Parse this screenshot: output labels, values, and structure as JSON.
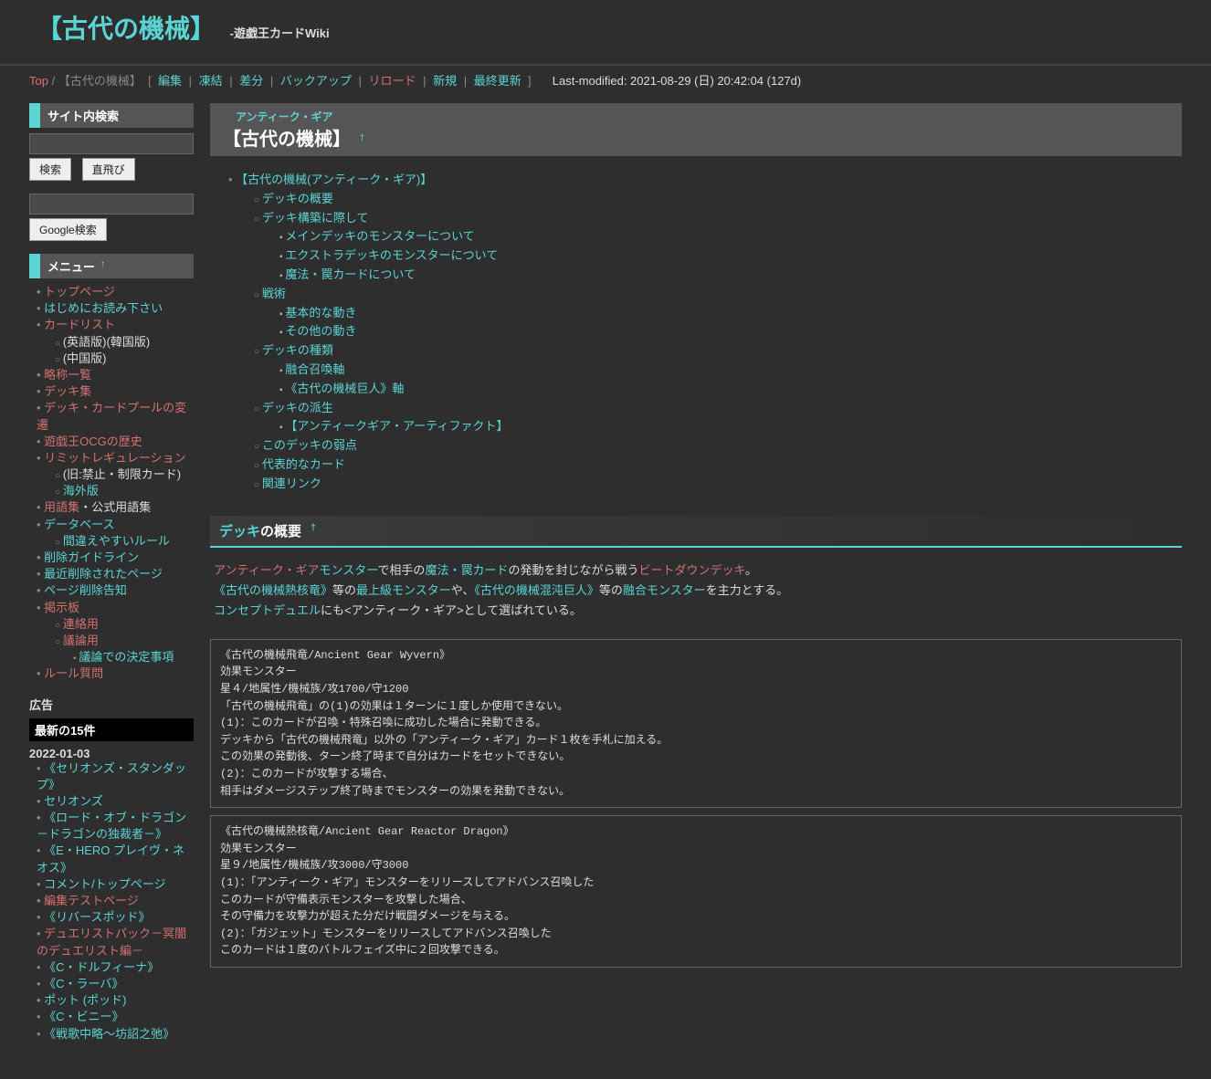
{
  "header": {
    "title": "【古代の機械】",
    "subtitle": "-遊戯王カードWiki"
  },
  "topbar": {
    "top": "Top",
    "here": "【古代の機械】",
    "links": [
      "編集",
      "凍結",
      "差分",
      "バックアップ",
      "リロード",
      "新規",
      "最終更新"
    ],
    "lastmod": "Last-modified: 2021-08-29 (日) 20:42:04 (127d)"
  },
  "sidebar": {
    "search_title": "サイト内検索",
    "btn_search": "検索",
    "btn_jump": "直飛び",
    "btn_google": "Google検索",
    "menu_title": "メニュー",
    "menu": [
      {
        "t": "トップページ",
        "r": 1
      },
      {
        "t": "はじめにお読み下さい"
      },
      {
        "t": "カードリスト",
        "r": 1,
        "sub": [
          {
            "t": "(英語版)(韓国版)"
          },
          {
            "t": "(中国版)"
          }
        ]
      },
      {
        "t": "略称一覧",
        "r": 1
      },
      {
        "t": "デッキ集",
        "r": 1
      },
      {
        "t": "デッキ・カードプールの変遷",
        "r": 1
      },
      {
        "t": "遊戯王OCGの歴史",
        "r": 1
      },
      {
        "t": "リミットレギュレーション",
        "r": 1,
        "sub": [
          {
            "t": "(旧:禁止・制限カード)"
          },
          {
            "t": "海外版"
          }
        ]
      },
      {
        "t": "用語集",
        "r": 1,
        "after": "・公式用語集"
      },
      {
        "t": "データベース",
        "sub": [
          {
            "t": "間違えやすいルール"
          }
        ]
      },
      {
        "t": "削除ガイドライン"
      },
      {
        "t": "最近削除されたページ"
      },
      {
        "t": "ページ削除告知"
      },
      {
        "t": "掲示板",
        "r": 1,
        "sub": [
          {
            "t": "連絡用",
            "r": 1
          },
          {
            "t": "議論用",
            "r": 1,
            "sub": [
              {
                "t": "議論での決定事項"
              }
            ]
          }
        ]
      },
      {
        "t": "ルール質問",
        "r": 1
      }
    ],
    "ad_label": "広告",
    "latest_title": "最新の15件",
    "latest_date": "2022-01-03",
    "latest": [
      "《セリオンズ・スタンダップ》",
      "セリオンズ",
      "《ロード・オブ・ドラゴン－ドラゴンの独裁者－》",
      "《E・HERO プレイヴ・ネオス》",
      "コメント/トップページ",
      "編集テストページ",
      "《リバースポッド》",
      "デュエリストパック－冥闇のデュエリスト編－",
      "《C・ドルフィーナ》",
      "《C・ラーバ》",
      "ポット (ポッド)",
      "《C・ビニー》",
      "《戦歌中略～坊詔之弛》"
    ],
    "latest_red": [
      5,
      7
    ]
  },
  "page": {
    "ruby": "アンティーク・ギア",
    "title": "【古代の機械】",
    "dagger": "†"
  },
  "toc": {
    "top": "【古代の機械(アンティーク・ギア)】",
    "l1": [
      {
        "t": "デッキの概要"
      },
      {
        "t": "デッキ構築に際して",
        "sub": [
          "メインデッキのモンスターについて",
          "エクストラデッキのモンスターについて",
          "魔法・罠カードについて"
        ]
      },
      {
        "t": "戦術",
        "sub": [
          "基本的な動き",
          "その他の動き"
        ]
      },
      {
        "t": "デッキの種類",
        "sub": [
          "融合召喚軸",
          "《古代の機械巨人》軸"
        ]
      },
      {
        "t": "デッキの派生",
        "sub": [
          "【アンティークギア・アーティファクト】"
        ]
      },
      {
        "t": "このデッキの弱点"
      },
      {
        "t": "代表的なカード"
      },
      {
        "t": "関連リンク"
      }
    ]
  },
  "section1": {
    "head_link": "デッキ",
    "head_rest": "の概要",
    "dagger": "†",
    "para": {
      "a": "アンティーク・ギア",
      "b": "モンスター",
      "c": "で相手の",
      "d": "魔法・罠カード",
      "e": "の発動を封じながら戦う",
      "f": "ビートダウンデッキ",
      "g": "。",
      "h": "《古代の機械熱核竜》",
      "i": "等の",
      "j": "最上級モンスター",
      "k": "や、",
      "l": "《古代の機械混沌巨人》",
      "m": "等の",
      "n": "融合モンスター",
      "o": "を主力とする。",
      "p": "コンセプトデュエル",
      "q": "にも<アンティーク・ギア>として選ばれている。"
    }
  },
  "card1": [
    "《古代の機械飛竜/Ancient Gear Wyvern》",
    "効果モンスター",
    "星４/地属性/機械族/攻1700/守1200",
    "「古代の機械飛竜」の(1)の効果は１ターンに１度しか使用できない。",
    "(1)：このカードが召喚・特殊召喚に成功した場合に発動できる。",
    "デッキから「古代の機械飛竜」以外の「アンティーク・ギア」カード１枚を手札に加える。",
    "この効果の発動後、ターン終了時まで自分はカードをセットできない。",
    "(2)：このカードが攻撃する場合、",
    "相手はダメージステップ終了時までモンスターの効果を発動できない。"
  ],
  "card2": [
    "《古代の機械熱核竜/Ancient Gear Reactor Dragon》",
    "効果モンスター",
    "星９/地属性/機械族/攻3000/守3000",
    "(1)：「アンティーク・ギア」モンスターをリリースしてアドバンス召喚した",
    "このカードが守備表示モンスターを攻撃した場合、",
    "その守備力を攻撃力が超えた分だけ戦闘ダメージを与える。",
    "(2)：「ガジェット」モンスターをリリースしてアドバンス召喚した",
    "このカードは１度のバトルフェイズ中に２回攻撃できる。"
  ]
}
